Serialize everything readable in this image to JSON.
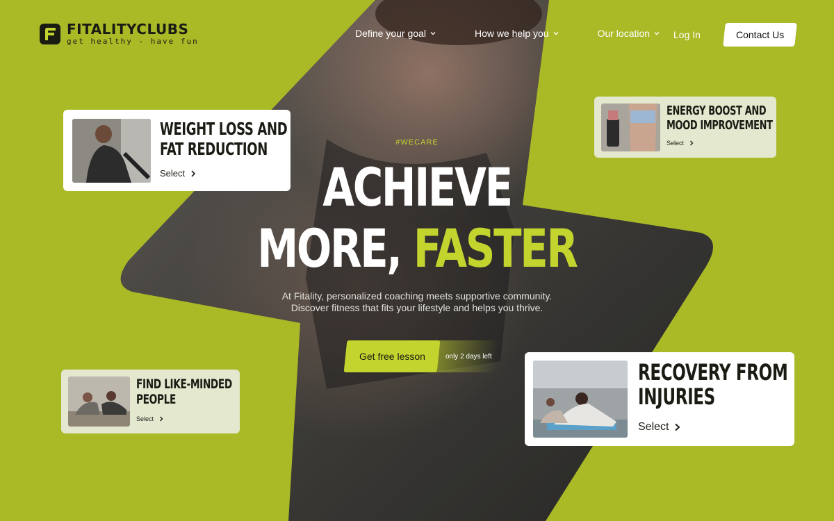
{
  "brand": {
    "name": "FITALITYCLUBS",
    "tagline": "get healthy - have fun"
  },
  "nav": {
    "items": [
      {
        "label": "Define your goal"
      },
      {
        "label": "How we help you"
      },
      {
        "label": "Our location"
      }
    ],
    "login_label": "Log In",
    "contact_label": "Contact Us"
  },
  "hero": {
    "tag": "#WECARE",
    "headline_line1": "ACHIEVE",
    "headline_line2_white": "MORE,",
    "headline_line2_accent": "FASTER",
    "sub_line1": "At Fitality, personalized coaching meets supportive community.",
    "sub_line2": "Discover fitness that fits your lifestyle and helps you thrive.",
    "cta_label": "Get free lesson",
    "cta_note": "only 2 days left"
  },
  "cards": {
    "weight": {
      "title_line1": "WEIGHT LOSS AND",
      "title_line2": "FAT REDUCTION",
      "select_label": "Select"
    },
    "energy": {
      "title_line1": "ENERGY BOOST AND",
      "title_line2": "MOOD IMPROVEMENT",
      "select_label": "Select"
    },
    "people": {
      "title_line1": "FIND LIKE-MINDED",
      "title_line2": "PEOPLE",
      "select_label": "Select"
    },
    "recovery": {
      "title_line1": "RECOVERY FROM",
      "title_line2": "INJURIES",
      "select_label": "Select"
    }
  },
  "colors": {
    "accent": "#c2d42d",
    "dark": "#1a1c14",
    "card_light": "#e3e8cf",
    "white": "#ffffff"
  },
  "icons": [
    "logo-f-icon",
    "chevron-down-icon",
    "chevron-right-icon"
  ]
}
